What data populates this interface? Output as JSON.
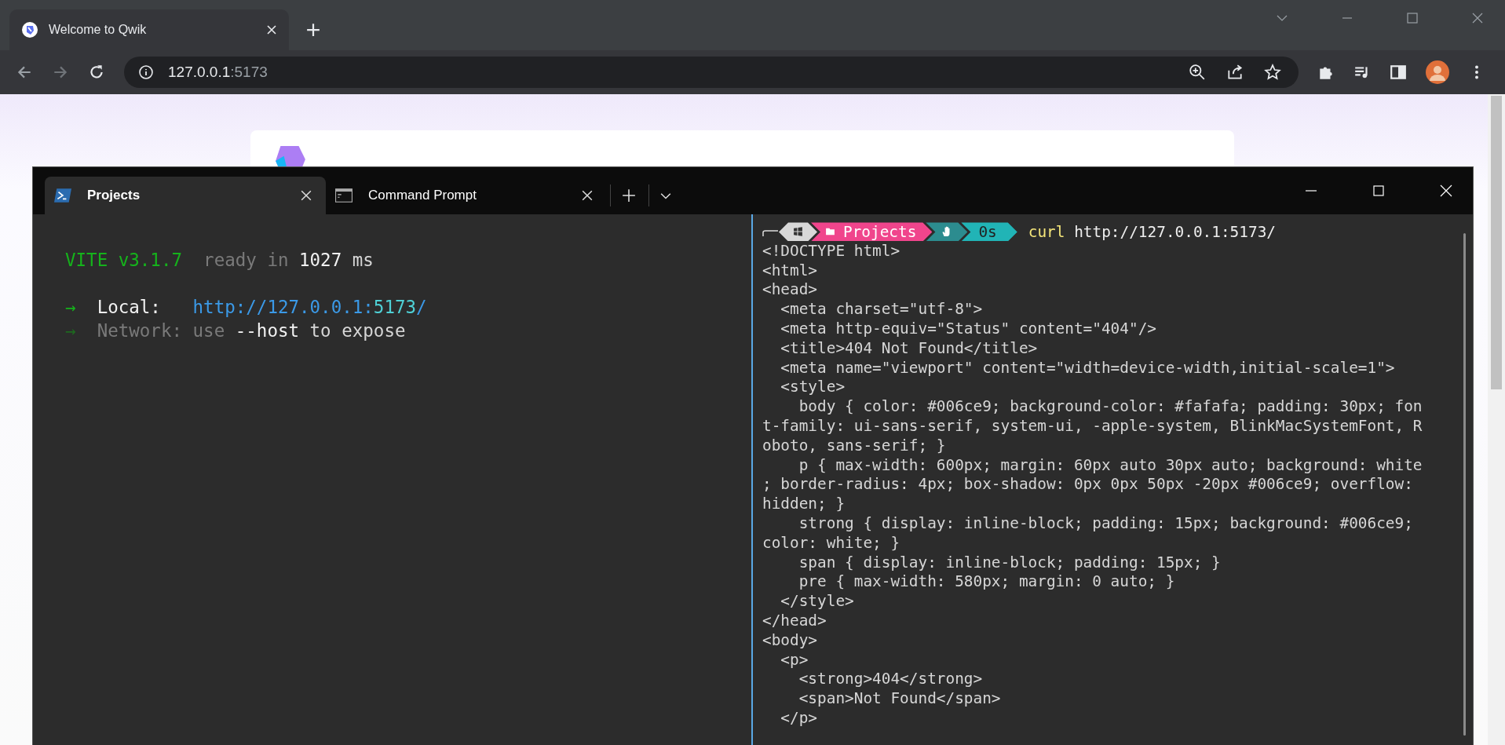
{
  "browser": {
    "tab": {
      "title": "Welcome to Qwik"
    },
    "address": {
      "host": "127.0.0.1",
      "port": ":5173"
    }
  },
  "terminal": {
    "tabs": [
      {
        "title": "Projects",
        "selected": true,
        "kind": "powershell"
      },
      {
        "title": "Command Prompt",
        "selected": false,
        "kind": "cmd"
      }
    ],
    "left_pane": {
      "banner": [
        {
          "text": "VITE v3.1.7",
          "kind": "green"
        },
        {
          "text": "  ready in ",
          "kind": "dim"
        },
        {
          "text": "1027",
          "kind": "bright"
        },
        {
          "text": " ms",
          "kind": "normal"
        }
      ],
      "urls": [
        [
          {
            "text": "→",
            "kind": "arrow"
          },
          {
            "text": "  Local:   ",
            "kind": "bright"
          },
          {
            "text": "http://127.0.0.1:",
            "kind": "link"
          },
          {
            "text": "5173",
            "kind": "port"
          },
          {
            "text": "/",
            "kind": "link"
          }
        ],
        [
          {
            "text": "→",
            "kind": "arrow-dim"
          },
          {
            "text": "  Network: use ",
            "kind": "dim"
          },
          {
            "text": "--host",
            "kind": "bright"
          },
          {
            "text": " to expose",
            "kind": "normal"
          }
        ]
      ]
    },
    "right_pane": {
      "prompt": {
        "segments": [
          {
            "kind": "os"
          },
          {
            "kind": "folder",
            "text": "Projects"
          },
          {
            "kind": "hand"
          },
          {
            "kind": "time",
            "text": "0s"
          }
        ],
        "command": "curl",
        "argument": " http://127.0.0.1:5173/"
      },
      "lines": [
        "<!DOCTYPE html>",
        "<html>",
        "<head>",
        "  <meta charset=\"utf-8\">",
        "  <meta http-equiv=\"Status\" content=\"404\"/>",
        "  <title>404 Not Found</title>",
        "  <meta name=\"viewport\" content=\"width=device-width,initial-scale=1\">",
        "  <style>",
        "    body { color: #006ce9; background-color: #fafafa; padding: 30px; fon",
        "t-family: ui-sans-serif, system-ui, -apple-system, BlinkMacSystemFont, R",
        "oboto, sans-serif; }",
        "    p { max-width: 600px; margin: 60px auto 30px auto; background: white",
        "; border-radius: 4px; box-shadow: 0px 0px 50px -20px #006ce9; overflow:",
        "hidden; }",
        "    strong { display: inline-block; padding: 15px; background: #006ce9;",
        "color: white; }",
        "    span { display: inline-block; padding: 15px; }",
        "    pre { max-width: 580px; margin: 0 auto; }",
        "  </style>",
        "</head>",
        "<body>",
        "  <p>",
        "    <strong>404</strong>",
        "    <span>Not Found</span>",
        "  </p>"
      ]
    }
  }
}
